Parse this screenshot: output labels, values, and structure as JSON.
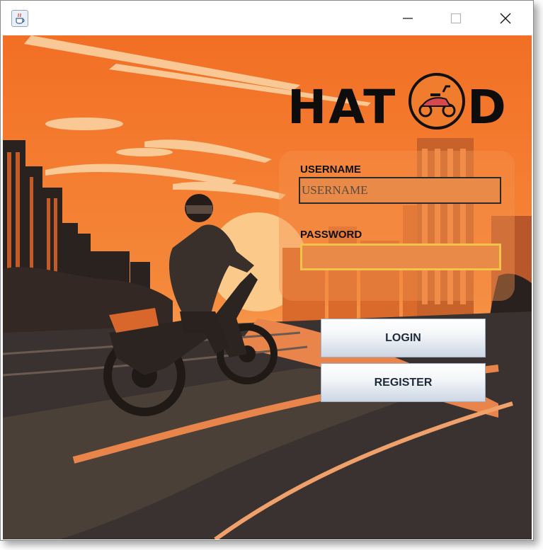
{
  "window": {
    "app_icon": "java-cup-icon",
    "controls": {
      "minimize": "minimize-icon",
      "maximize": "maximize-icon",
      "close": "close-icon"
    }
  },
  "logo": {
    "text_left": "HAT",
    "text_right": "D",
    "emblem": "scooter-emblem-icon"
  },
  "form": {
    "username_label": "USERNAME",
    "username_placeholder": "USERNAME",
    "password_label": "PASSWORD",
    "password_value": ""
  },
  "buttons": {
    "login": "LOGIN",
    "register": "REGISTER"
  },
  "colors": {
    "sky": "#f47a2c",
    "sky_light": "#f9b56e",
    "city_dark": "#2a221f",
    "field_bg": "#e98a48",
    "focus_border": "#f3c24a",
    "button_top": "#ffffff",
    "button_bottom": "#cdd7e4"
  }
}
